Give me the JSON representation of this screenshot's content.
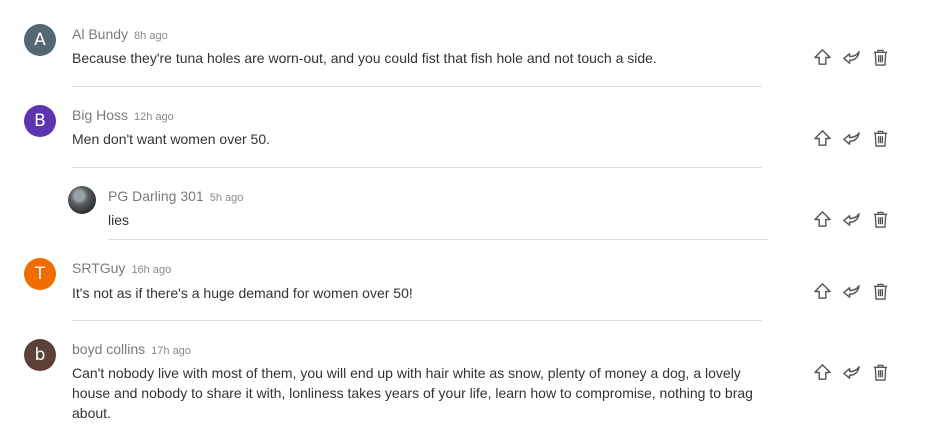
{
  "comments": [
    {
      "avatar_letter": "A",
      "avatar_color": "#546773",
      "author": "Al Bundy",
      "time": "8h ago",
      "text": "Because they're tuna holes are worn-out, and you could fist that fish hole and not touch a side."
    },
    {
      "avatar_letter": "B",
      "avatar_color": "#5e35b1",
      "author": "Big Hoss",
      "time": "12h ago",
      "text": "Men don't want women over 50."
    },
    {
      "avatar_letter": "",
      "avatar_color": "#4a4f52",
      "author": "PG Darling 301",
      "time": "5h ago",
      "text": "lies"
    },
    {
      "avatar_letter": "T",
      "avatar_color": "#ef6c00",
      "author": "SRTGuy",
      "time": "16h ago",
      "text": "It's not as if there's a huge demand for women over 50!"
    },
    {
      "avatar_letter": "b",
      "avatar_color": "#5d4037",
      "author": "boyd collins",
      "time": "17h ago",
      "text": "Can't nobody live with most of them, you will end up with hair white as snow, plenty of money a dog, a lovely house and nobody to share it with, lonliness takes years of your life, learn how to compromise, nothing to brag about."
    }
  ],
  "icons": {
    "upvote": "upvote-arrow-icon",
    "reply": "reply-arrow-icon",
    "delete": "trash-icon",
    "icon_color": "#555555"
  }
}
